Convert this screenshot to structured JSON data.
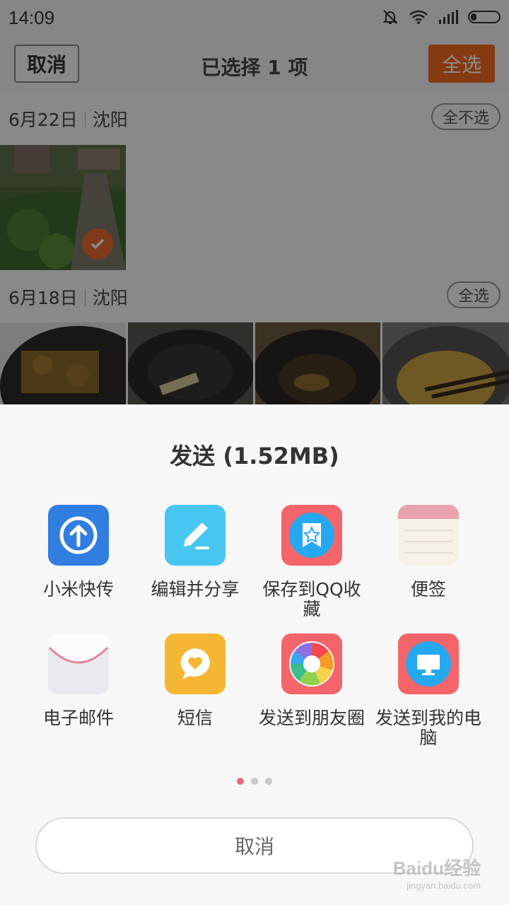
{
  "status_bar": {
    "time": "14:09",
    "icons": [
      "mute-bell-icon",
      "wifi-icon",
      "signal-icon",
      "battery-icon"
    ]
  },
  "header": {
    "cancel_label": "取消",
    "title": "已选择 1 项",
    "select_all_label": "全选",
    "accent": "#f26b22"
  },
  "groups": [
    {
      "date": "6月22日",
      "location": "沈阳",
      "action_label": "全不选"
    },
    {
      "date": "6月18日",
      "location": "沈阳",
      "action_label": "全选"
    }
  ],
  "share_sheet": {
    "title": "发送 (1.52MB)",
    "apps": [
      {
        "label": "小米快传",
        "icon": "mi-drop-icon"
      },
      {
        "label": "编辑并分享",
        "icon": "edit-share-icon"
      },
      {
        "label": "保存到QQ收藏",
        "icon": "qq-favorites-icon"
      },
      {
        "label": "便签",
        "icon": "notes-icon"
      },
      {
        "label": "电子邮件",
        "icon": "email-icon"
      },
      {
        "label": "短信",
        "icon": "sms-icon"
      },
      {
        "label": "发送到朋友圈",
        "icon": "moments-icon"
      },
      {
        "label": "发送到我的电脑",
        "icon": "send-to-pc-icon"
      }
    ],
    "page_count": 3,
    "current_page": 1,
    "cancel_label": "取消"
  },
  "watermark": {
    "main": "Baidu经验",
    "sub": "jingyan.baidu.com"
  }
}
